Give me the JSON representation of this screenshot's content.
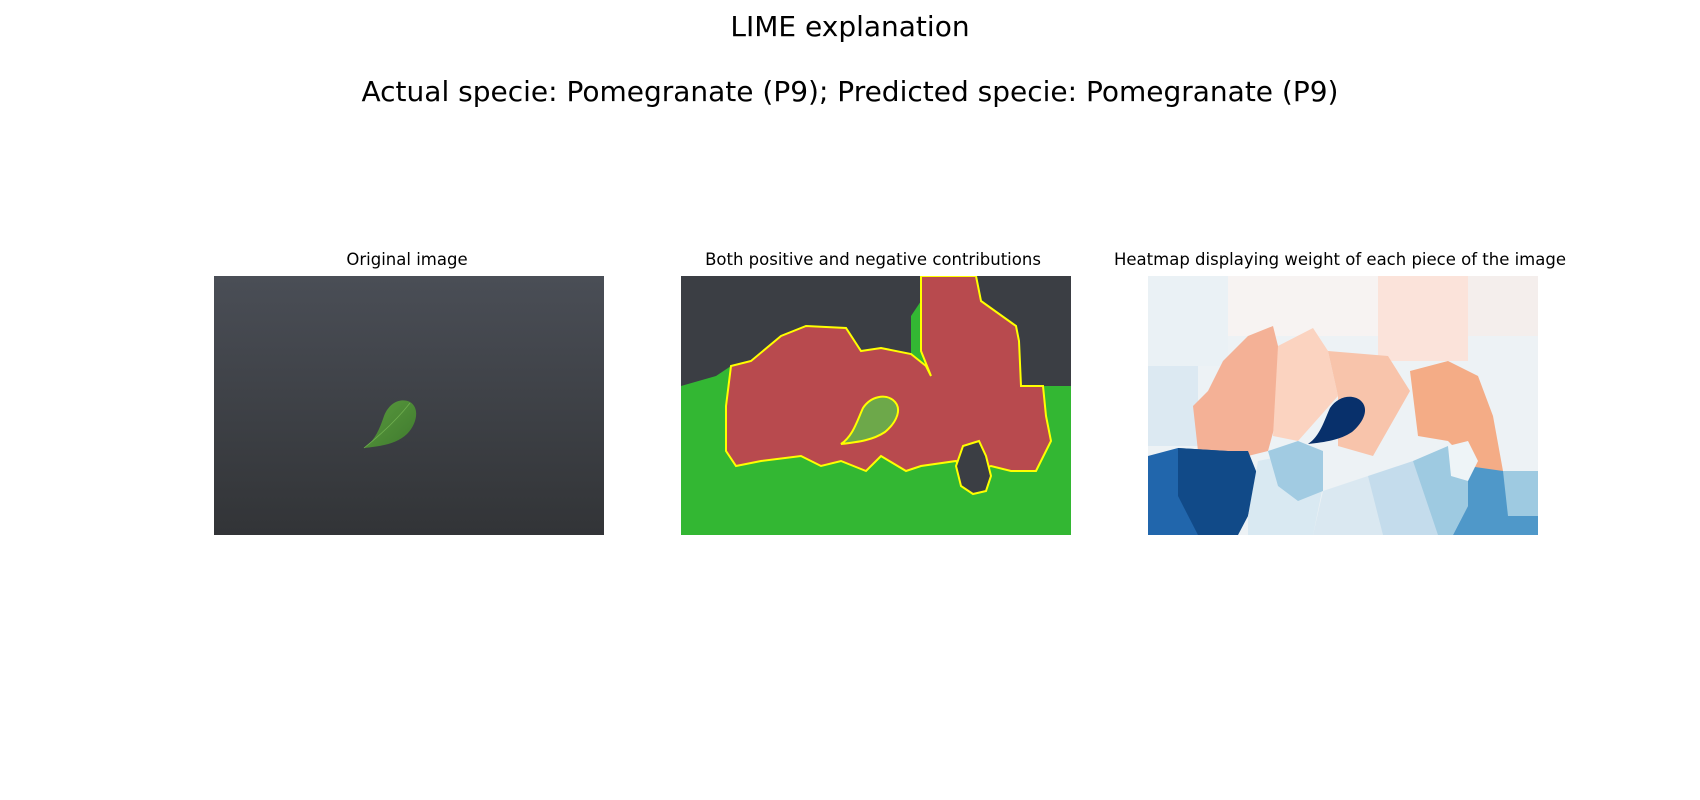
{
  "figure": {
    "title": "LIME explanation",
    "subtitle": "Actual specie: Pomegranate (P9); Predicted specie: Pomegranate (P9)"
  },
  "panels": [
    {
      "title": "Original image"
    },
    {
      "title": "Both positive and negative contributions"
    },
    {
      "title": "Heatmap displaying weight of each piece of the image"
    }
  ],
  "colors": {
    "background": "#3b3e44",
    "leaf": "#4f8a3a",
    "positive_overlay": "#b84a4e",
    "negative_overlay": "#33b733",
    "boundary": "#ffff00",
    "heatmap_strong_positive": "#08306b",
    "heatmap_weak_negative": "#f4ac86"
  },
  "image_content": {
    "subject": "single green leaf on dark grey background",
    "heatmap_colormap": "red-white-blue"
  }
}
